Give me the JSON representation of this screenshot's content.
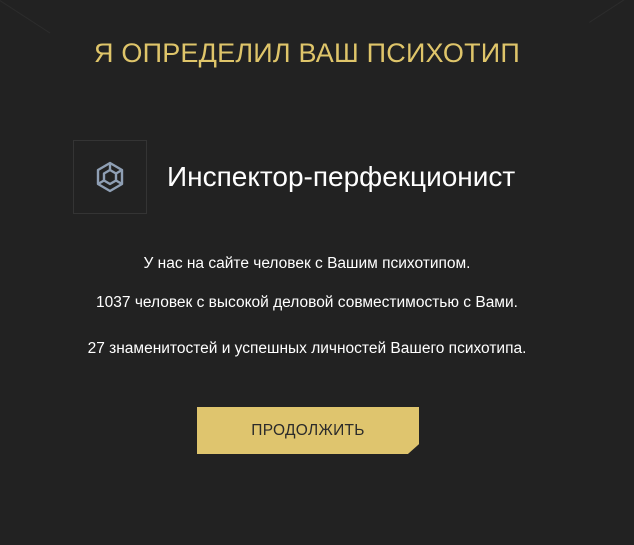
{
  "title": "Я ОПРЕДЕЛИЛ ВАШ ПСИХОТИП",
  "psychotype": {
    "icon": "hexagon-cube-icon",
    "name": "Инспектор-перфекционист"
  },
  "info_lines": [
    "У нас на сайте человек с Вашим психотипом.",
    "1037 человек с высокой деловой совместимостью с Вами.",
    "27 знаменитостей и успешных личностей Вашего психотипа."
  ],
  "continue_button": {
    "label": "ПРОДОЛЖИТЬ"
  },
  "colors": {
    "background": "#222222",
    "accent_gold": "#dfc56a",
    "button_gold": "#dfc56e",
    "text": "#ffffff",
    "icon": "#8f9fb4"
  }
}
